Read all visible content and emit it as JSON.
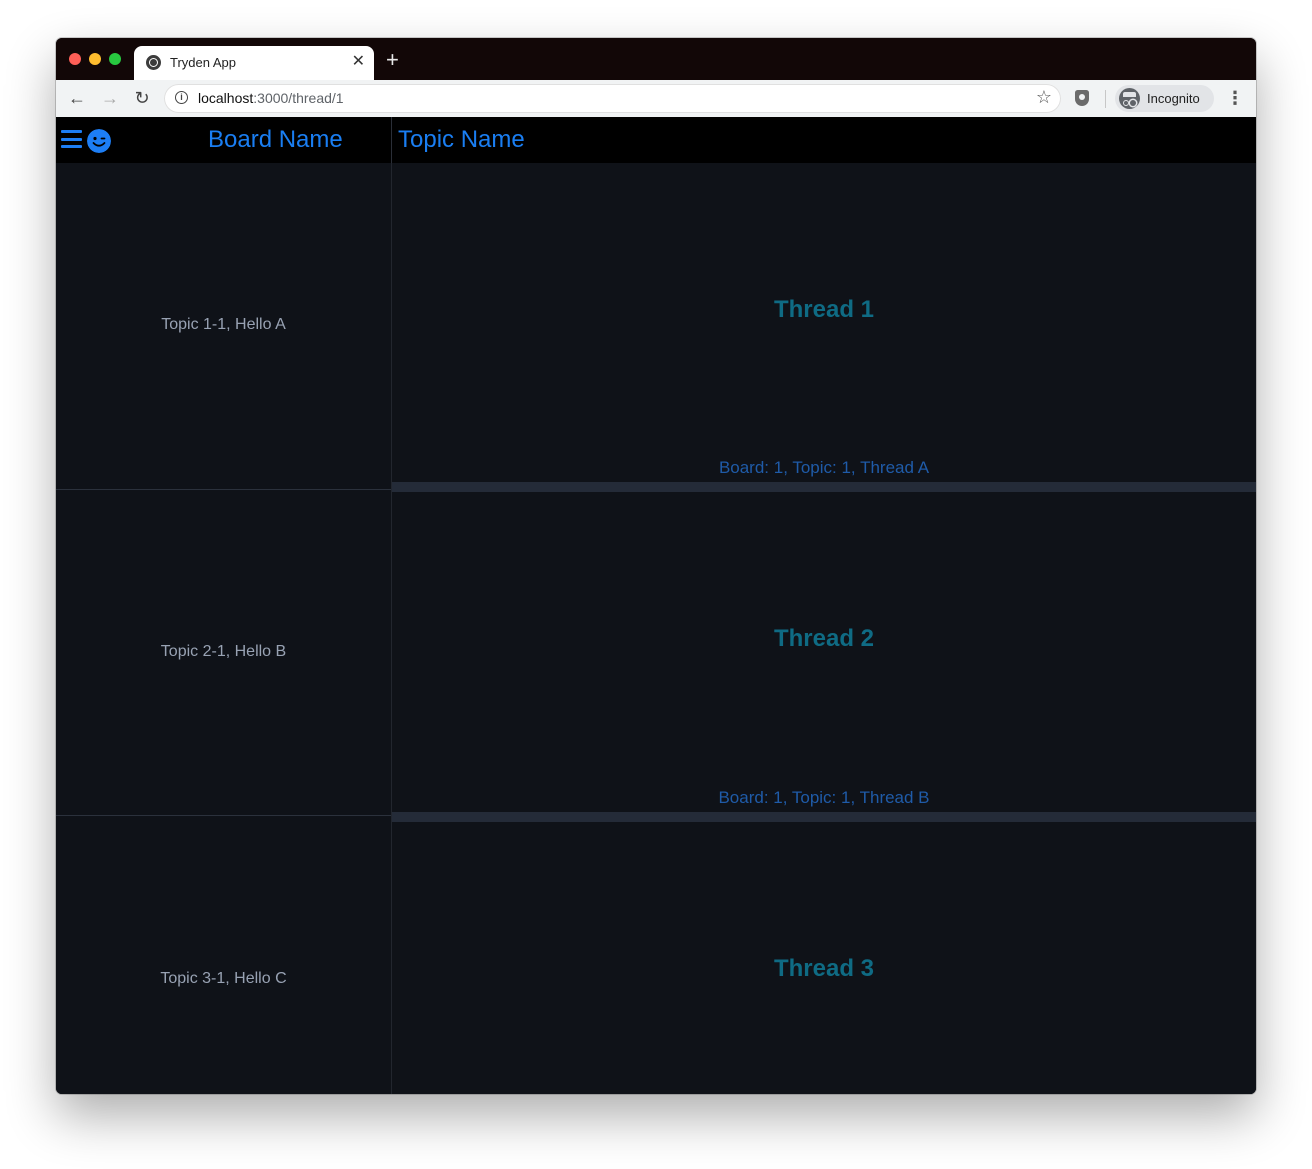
{
  "browser": {
    "tab_title": "Tryden App",
    "tab_close": "✕",
    "new_tab": "+",
    "url_host": "localhost",
    "url_path": ":3000/thread/1",
    "profile_label": "Incognito",
    "icons": [
      "back-arrow-icon",
      "forward-arrow-icon",
      "reload-icon",
      "info-icon",
      "star-icon",
      "shield-icon",
      "incognito-icon",
      "more-menu-icon"
    ]
  },
  "header": {
    "board_name": "Board Name",
    "topic_name": "Topic Name",
    "accent_color": "#1a7ef2"
  },
  "sidebar": {
    "topics": [
      {
        "label": "Topic 1-1, Hello A"
      },
      {
        "label": "Topic 2-1, Hello B"
      },
      {
        "label": "Topic 3-1, Hello C"
      }
    ]
  },
  "threads": [
    {
      "title": "Thread 1",
      "meta": "Board: 1, Topic: 1, Thread A"
    },
    {
      "title": "Thread 2",
      "meta": "Board: 1, Topic: 1, Thread B"
    },
    {
      "title": "Thread 3",
      "meta": ""
    }
  ],
  "colors": {
    "background": "#0f1218",
    "header_bg": "#000000",
    "thread_title": "#0f6b84",
    "thread_meta": "#1f5ba8",
    "topic_text": "#98a2b3"
  }
}
